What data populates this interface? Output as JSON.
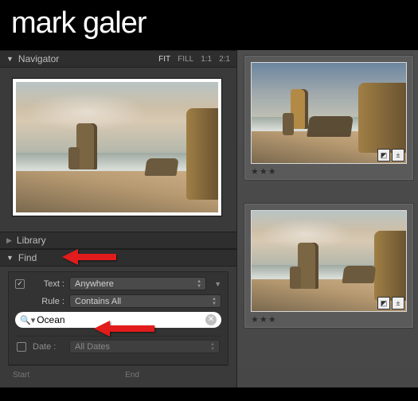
{
  "brand": "mark galer",
  "navigator": {
    "title": "Navigator",
    "zoom": [
      "FIT",
      "FILL",
      "1:1",
      "2:1"
    ]
  },
  "library": {
    "title": "Library"
  },
  "find": {
    "title": "Find",
    "text_label": "Text :",
    "text_enabled": true,
    "text_scope": "Anywhere",
    "rule_label": "Rule :",
    "rule_value": "Contains All",
    "search_value": "Ocean",
    "date_label": "Date :",
    "date_enabled": false,
    "date_value": "All Dates",
    "start_label": "Start",
    "end_label": "End"
  },
  "grid": {
    "stars": "★★★"
  }
}
